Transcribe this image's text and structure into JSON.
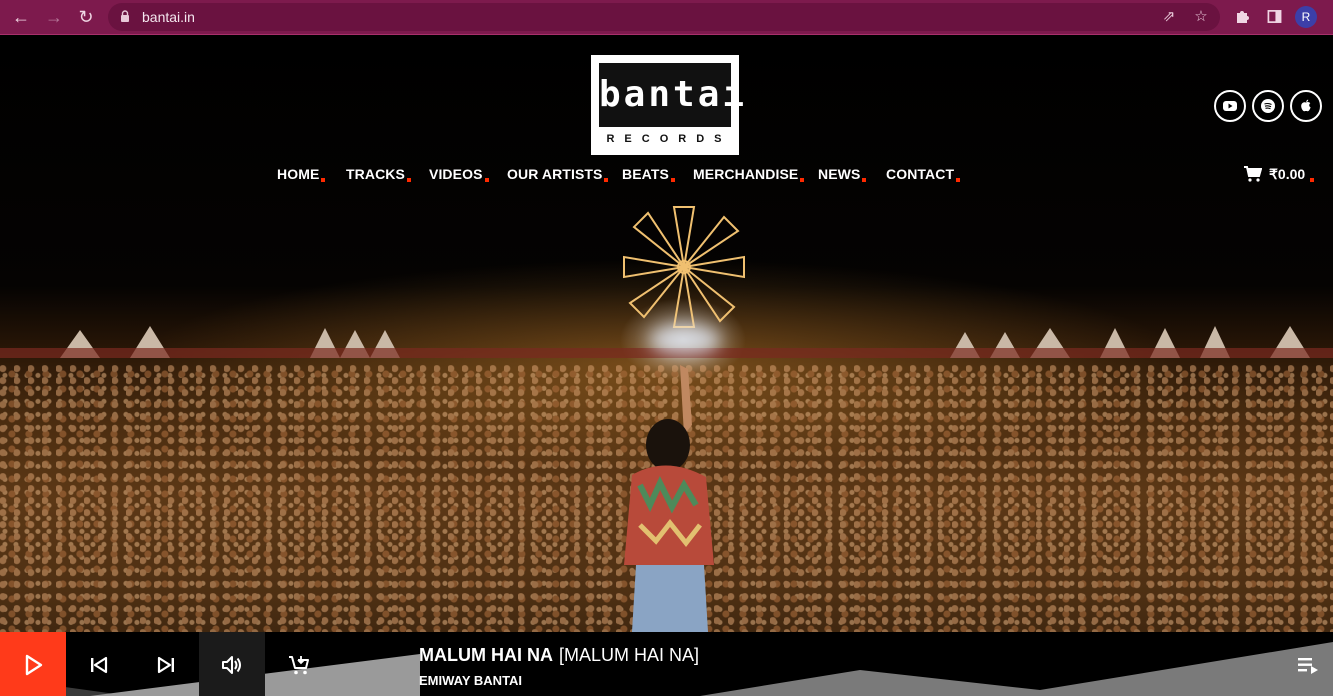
{
  "browser": {
    "url": "bantai.in",
    "profile_initial": "R",
    "theme_color": "#7d1a4d"
  },
  "logo": {
    "word": "bantai",
    "sub": "RECORDS"
  },
  "social": [
    "youtube-icon",
    "spotify-icon",
    "apple-icon"
  ],
  "nav": {
    "items": [
      "HOME",
      "TRACKS",
      "VIDEOS",
      "OUR ARTISTS",
      "BEATS",
      "MERCHANDISE",
      "NEWS",
      "CONTACT"
    ],
    "accent": "#ff2a00"
  },
  "cart": {
    "amount": "₹0.00"
  },
  "player": {
    "title": "MALUM HAI NA",
    "title_bracket": "[MALUM HAI NA]",
    "artist": "EMIWAY BANTAI",
    "accent": "#ff3a1a"
  }
}
